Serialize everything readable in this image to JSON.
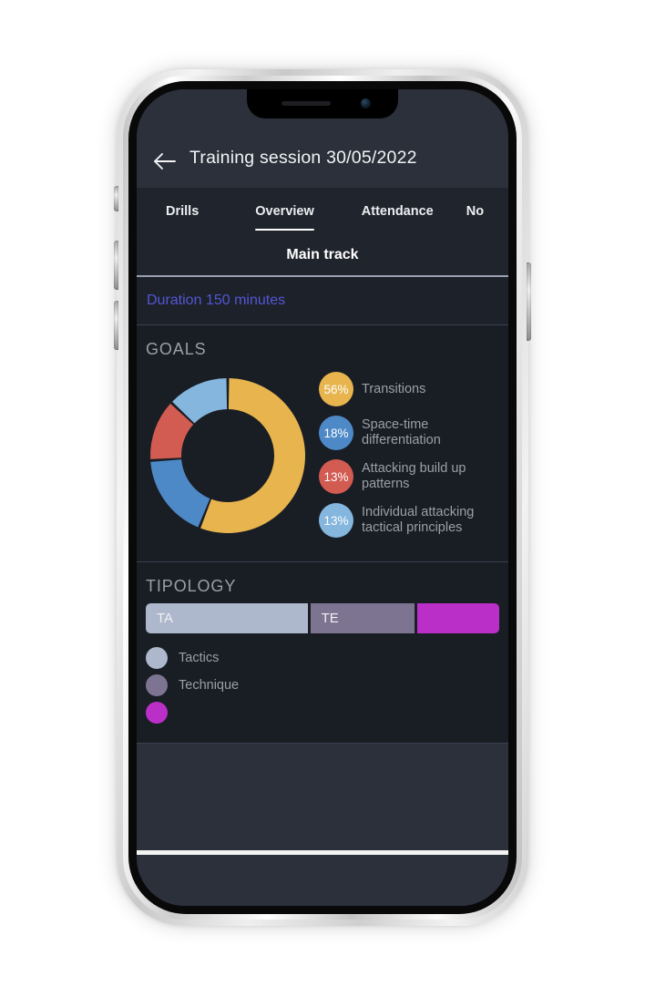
{
  "appbar": {
    "back_icon": "arrow-left-icon",
    "title": "Training session 30/05/2022"
  },
  "tabs": {
    "items": [
      {
        "label": "Drills",
        "active": false
      },
      {
        "label": "Overview",
        "active": true
      },
      {
        "label": "Attendance",
        "active": false
      },
      {
        "label": "No",
        "active": false
      }
    ]
  },
  "subtab": {
    "label": "Main track"
  },
  "duration": {
    "text": "Duration 150 minutes",
    "color": "#5257d4"
  },
  "goals": {
    "title": "GOALS",
    "legend": [
      {
        "percent": "56%",
        "label": "Transitions",
        "color": "#e7b44e"
      },
      {
        "percent": "18%",
        "label": "Space-time differentiation",
        "color": "#4e89c7"
      },
      {
        "percent": "13%",
        "label": "Attacking build up patterns",
        "color": "#d25b52"
      },
      {
        "percent": "13%",
        "label": "Individual attacking tactical principles",
        "color": "#84b6de"
      }
    ]
  },
  "tipology": {
    "title": "TIPOLOGY",
    "bar": [
      {
        "label": "TA",
        "color": "#aeb8cd",
        "width_pct": 46.5
      },
      {
        "label": "TE",
        "color": "#7d7491",
        "width_pct": 30.0
      },
      {
        "label": "",
        "color": "#bb2fc9",
        "width_pct": 23.5
      }
    ],
    "legend": [
      {
        "label": "Tactics",
        "color": "#aeb8cd"
      },
      {
        "label": "Technique",
        "color": "#7d7491"
      },
      {
        "label": "",
        "color": "#bb2fc9"
      }
    ]
  },
  "chart_data": {
    "type": "pie",
    "title": "GOALS",
    "categories": [
      "Transitions",
      "Space-time differentiation",
      "Attacking build up patterns",
      "Individual attacking tactical principles"
    ],
    "values": [
      56,
      18,
      13,
      13
    ],
    "value_labels": [
      "56%",
      "18%",
      "13%",
      "13%"
    ],
    "colors": [
      "#e7b44e",
      "#4e89c7",
      "#d25b52",
      "#84b6de"
    ],
    "donut": true,
    "inner_radius_ratio": 0.6,
    "start_angle_deg": -90,
    "direction": "clockwise",
    "legend_position": "right",
    "xlabel": "",
    "ylabel": ""
  }
}
